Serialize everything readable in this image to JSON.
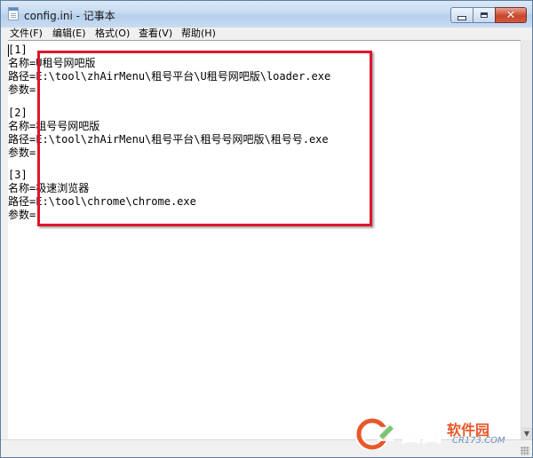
{
  "window": {
    "title": "config.ini - 记事本"
  },
  "menu": [
    {
      "label": "文件(F)"
    },
    {
      "label": "编辑(E)"
    },
    {
      "label": "格式(O)"
    },
    {
      "label": "查看(V)"
    },
    {
      "label": "帮助(H)"
    }
  ],
  "editor": {
    "lines": [
      "[1]",
      "名称=U租号网吧版",
      "路径=E:\\tool\\zhAirMenu\\租号平台\\U租号网吧版\\loader.exe",
      "参数=",
      "",
      "[2]",
      "名称=租号号网吧版",
      "路径=E:\\tool\\zhAirMenu\\租号平台\\租号号网吧版\\租号号.exe",
      "参数=",
      "",
      "[3]",
      "名称=极速浏览器",
      "路径=E:\\tool\\chrome\\chrome.exe",
      "参数="
    ]
  },
  "watermark": {
    "brand": "西西",
    "name": "软件园",
    "domain": "CR173.COM"
  },
  "colors": {
    "highlight_border": "#e0152a",
    "watermark_orange": "#e8572a"
  }
}
